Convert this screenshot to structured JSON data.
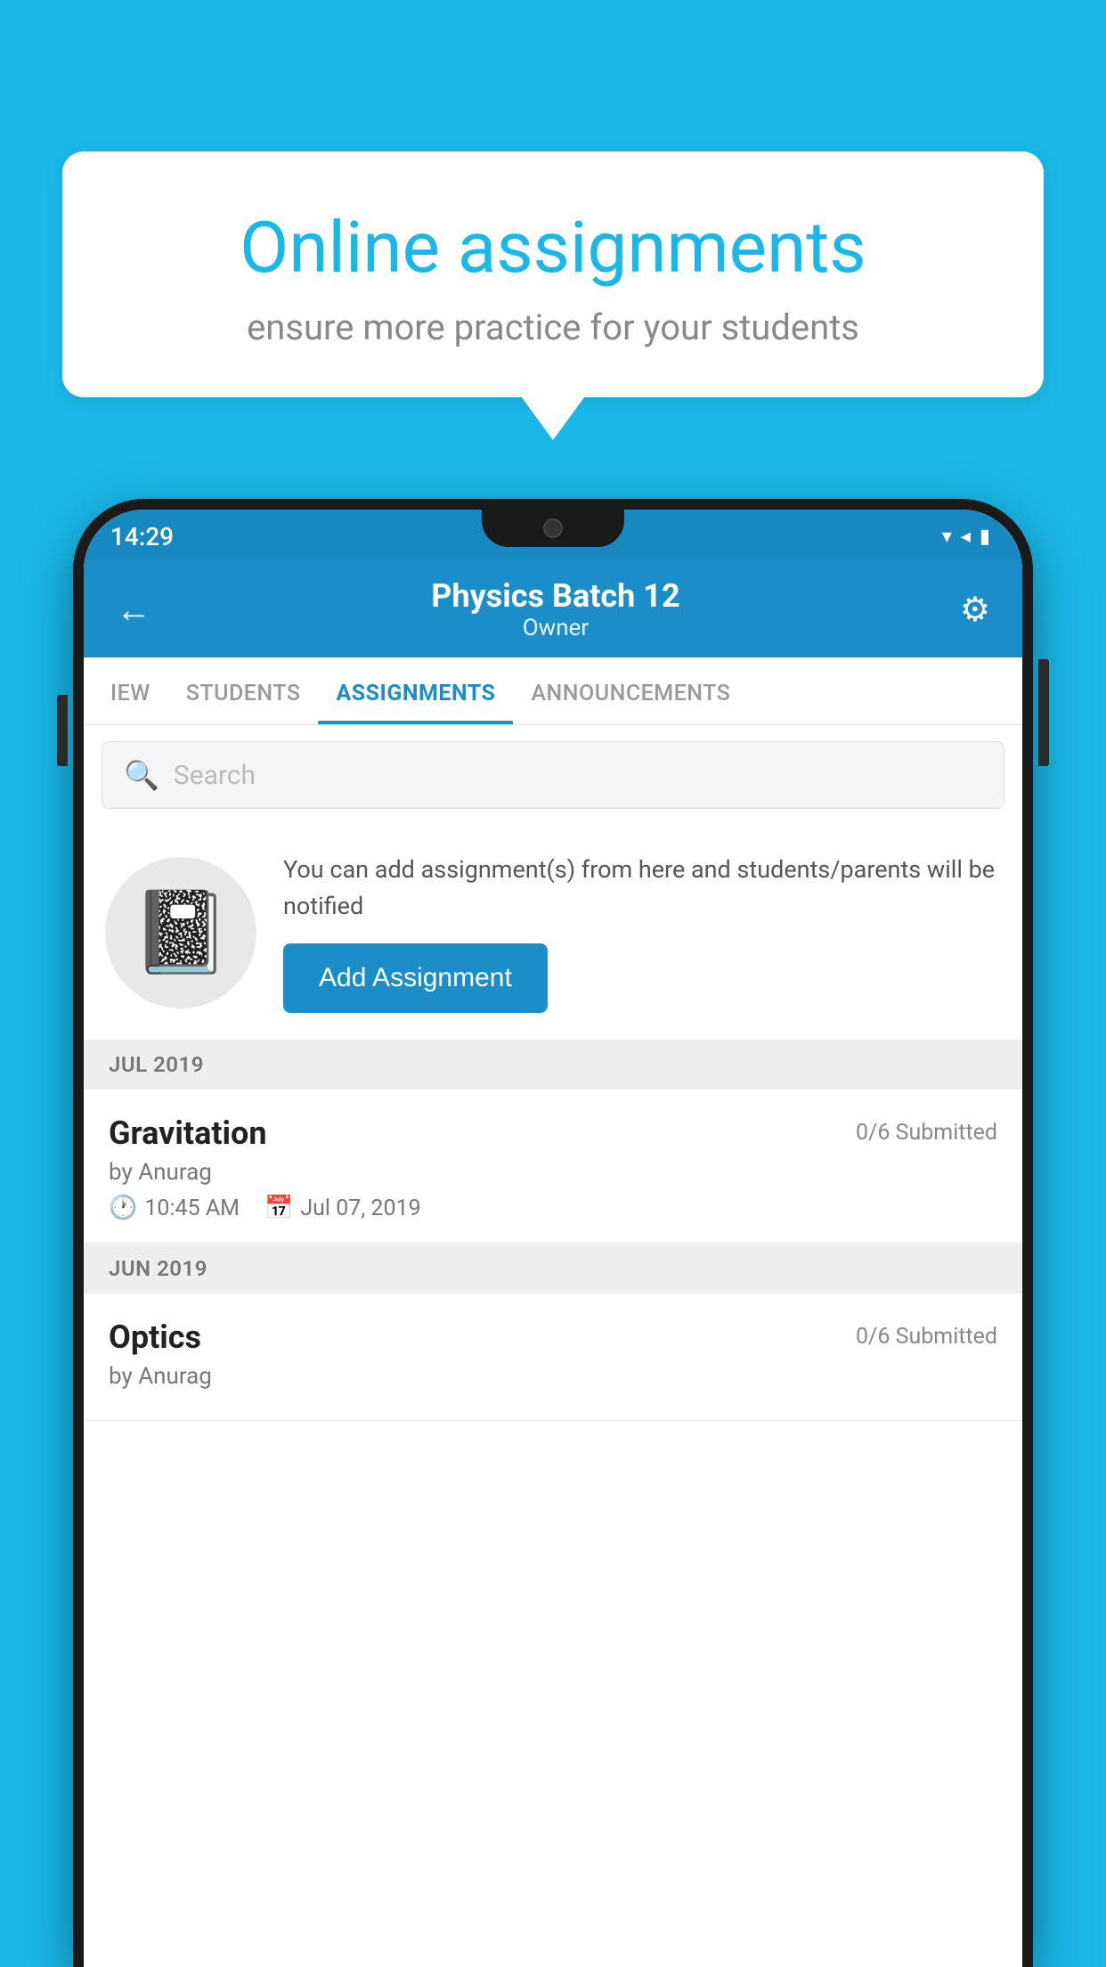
{
  "background_color": "#1ab8e8",
  "speech_bubble": {
    "title": "Online assignments",
    "subtitle": "ensure more practice for your students"
  },
  "status_bar": {
    "time": "14:29",
    "signal_icon": "▲",
    "wifi_icon": "▼",
    "battery_icon": "▮"
  },
  "header": {
    "title": "Physics Batch 12",
    "subtitle": "Owner",
    "back_label": "←",
    "settings_label": "⚙"
  },
  "tabs": [
    {
      "label": "IEW",
      "active": false
    },
    {
      "label": "STUDENTS",
      "active": false
    },
    {
      "label": "ASSIGNMENTS",
      "active": true
    },
    {
      "label": "ANNOUNCEMENTS",
      "active": false
    }
  ],
  "search": {
    "placeholder": "Search"
  },
  "add_assignment_section": {
    "description": "You can add assignment(s) from here and students/parents will be notified",
    "button_label": "Add Assignment"
  },
  "sections": [
    {
      "label": "JUL 2019",
      "items": [
        {
          "name": "Gravitation",
          "submitted": "0/6 Submitted",
          "author": "by Anurag",
          "time": "10:45 AM",
          "date": "Jul 07, 2019"
        }
      ]
    },
    {
      "label": "JUN 2019",
      "items": [
        {
          "name": "Optics",
          "submitted": "0/6 Submitted",
          "author": "by Anurag",
          "time": "",
          "date": ""
        }
      ]
    }
  ]
}
